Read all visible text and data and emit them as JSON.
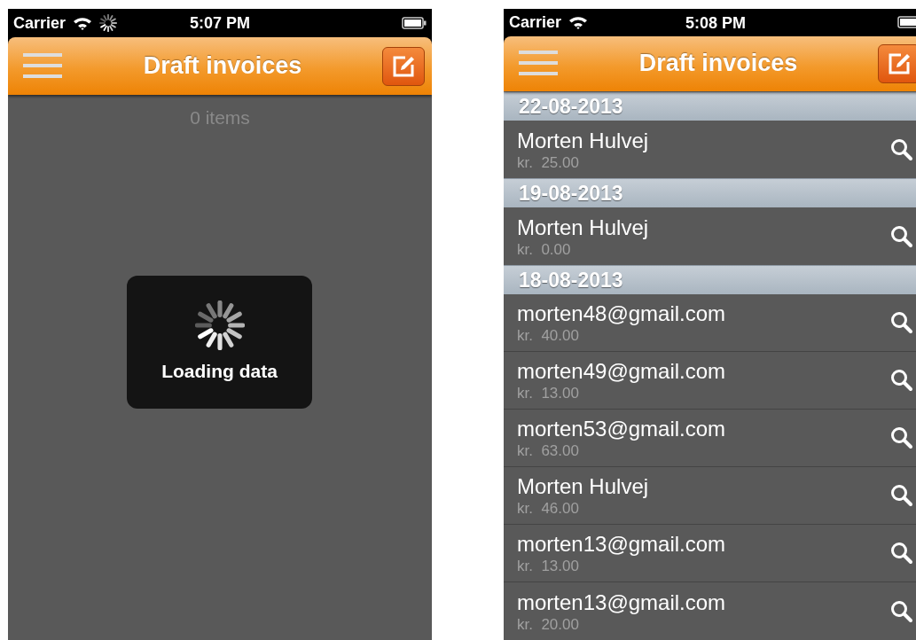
{
  "screens": [
    {
      "kind": "loading",
      "status_bar": {
        "carrier": "Carrier",
        "time": "5:07 PM",
        "network_activity": true
      },
      "title": "Draft invoices",
      "count": "0 items",
      "overlay": {
        "label": "Loading data"
      }
    },
    {
      "kind": "list",
      "status_bar": {
        "carrier": "Carrier",
        "time": "5:08 PM",
        "network_activity": false
      },
      "title": "Draft invoices",
      "sections": [
        {
          "date": "22-08-2013",
          "items": [
            {
              "name": "Morten Hulvej",
              "amount": "kr.  25.00"
            }
          ]
        },
        {
          "date": "19-08-2013",
          "items": [
            {
              "name": "Morten Hulvej",
              "amount": "kr.  0.00"
            }
          ]
        },
        {
          "date": "18-08-2013",
          "items": [
            {
              "name": "morten48@gmail.com",
              "amount": "kr.  40.00"
            },
            {
              "name": "morten49@gmail.com",
              "amount": "kr.  13.00"
            },
            {
              "name": "morten53@gmail.com",
              "amount": "kr.  63.00"
            },
            {
              "name": "Morten Hulvej",
              "amount": "kr.  46.00"
            },
            {
              "name": "morten13@gmail.com",
              "amount": "kr.  13.00"
            },
            {
              "name": "morten13@gmail.com",
              "amount": "kr.  20.00"
            }
          ]
        }
      ]
    }
  ]
}
